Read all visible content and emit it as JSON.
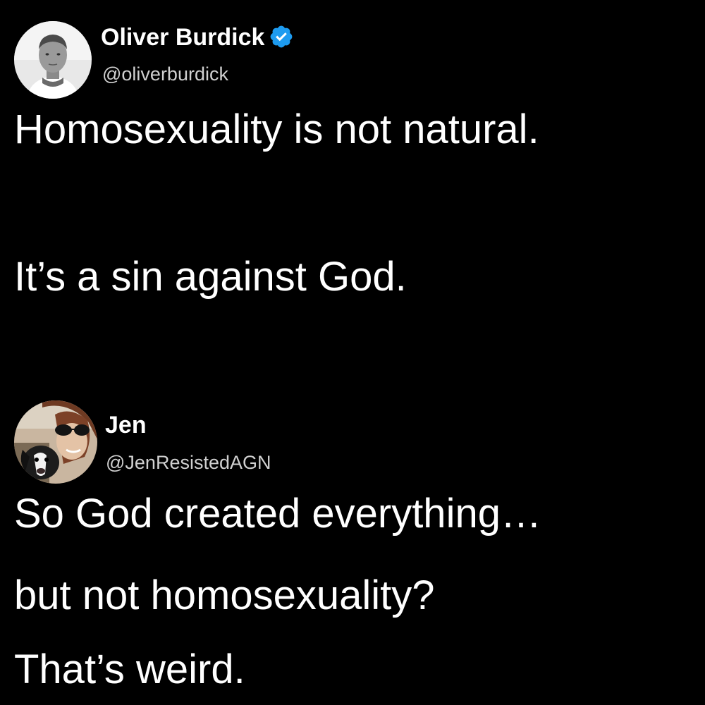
{
  "tweets": [
    {
      "author": {
        "name": "Oliver Burdick",
        "handle": "@oliverburdick",
        "verified": true,
        "verified_icon": "verified-badge-icon",
        "badge_color": "#1d9bf0"
      },
      "body": [
        "Homosexuality is not natural.",
        "It’s a sin against God."
      ]
    },
    {
      "author": {
        "name": "Jen",
        "handle": "@JenResistedAGN",
        "verified": false
      },
      "body": [
        "So God created everything…",
        "but not homosexuality?",
        "That’s weird."
      ]
    }
  ],
  "colors": {
    "background": "#000000",
    "text": "#ffffff",
    "handle": "#d0d0d0"
  }
}
